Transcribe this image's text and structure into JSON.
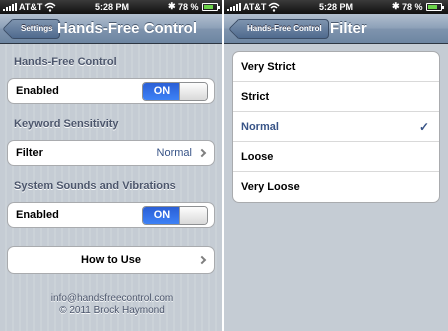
{
  "status_bar": {
    "carrier": "AT&T",
    "time": "5:28 PM",
    "battery": "78 %",
    "battery_level": 0.78,
    "signal_icon": "signal-bars-icon",
    "wifi_icon": "wifi-icon",
    "bluetooth_icon": "bluetooth-icon",
    "bluetooth_glyph": "✱"
  },
  "left_screen": {
    "nav": {
      "back_label": "Settings",
      "title": "Hands-Free Control"
    },
    "sections": {
      "hands_free": {
        "header": "Hands-Free Control",
        "enabled_label": "Enabled",
        "toggle_value": "ON"
      },
      "keyword": {
        "header": "Keyword Sensitivity",
        "filter_label": "Filter",
        "filter_value": "Normal"
      },
      "sounds": {
        "header": "System Sounds and Vibrations",
        "enabled_label": "Enabled",
        "toggle_value": "ON"
      },
      "how_to_use": "How to Use"
    },
    "footer": {
      "email": "info@handsfreecontrol.com",
      "copyright": "© 2011 Brock Haymond"
    }
  },
  "right_screen": {
    "nav": {
      "back_label": "Hands-Free Control",
      "title": "Filter"
    },
    "options": [
      "Very Strict",
      "Strict",
      "Normal",
      "Loose",
      "Very Loose"
    ],
    "selected": "Normal",
    "checkmark": "✓"
  },
  "colors": {
    "nav_blue": "#6d85a1",
    "toggle_blue": "#3e82f6",
    "value_blue": "#385487",
    "background": "#c5ccd4"
  }
}
